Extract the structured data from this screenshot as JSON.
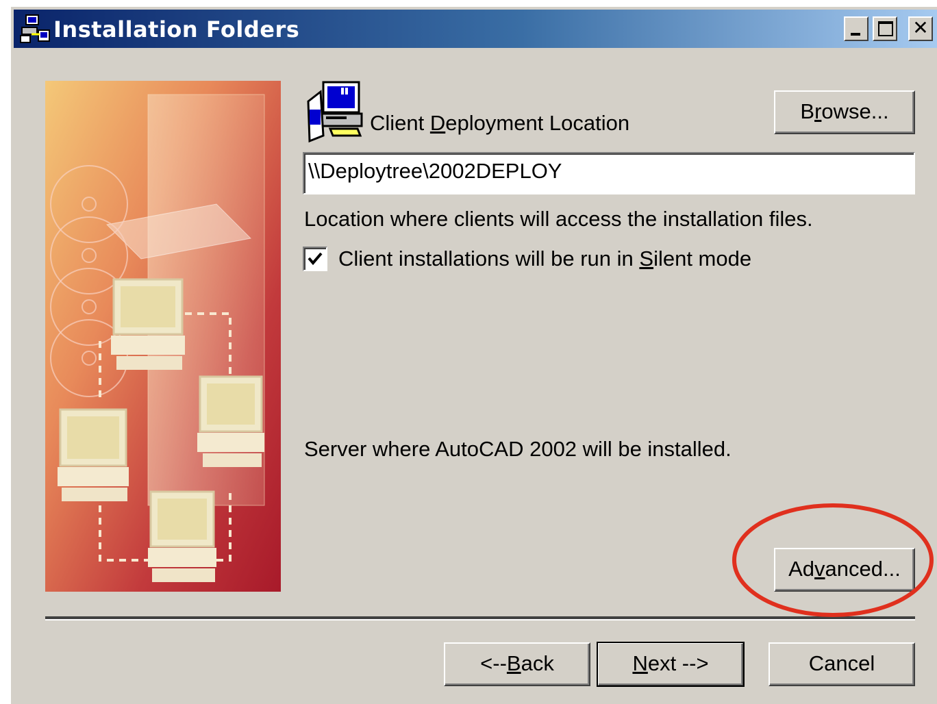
{
  "window": {
    "title": "Installation Folders"
  },
  "icons": {
    "app": "installer-icon",
    "deploy": "client-deployment-icon",
    "minimize": "minimize-icon",
    "maximize": "maximize-icon",
    "close": "close-icon"
  },
  "deployment": {
    "label_prefix": "Client ",
    "label_mnemonic": "D",
    "label_suffix": "eployment Location",
    "browse_prefix": "B",
    "browse_mnemonic": "r",
    "browse_suffix": "owse...",
    "path_value": "\\\\Deploytree\\2002DEPLOY",
    "hint": "Location where clients will access the installation files."
  },
  "silent": {
    "checked": true,
    "label_prefix": "Client installations will be run in ",
    "label_mnemonic": "S",
    "label_suffix": "ilent mode"
  },
  "server": {
    "text": "Server where AutoCAD 2002 will be installed."
  },
  "advanced": {
    "prefix": "Ad",
    "mnemonic": "v",
    "suffix": "anced..."
  },
  "nav": {
    "back_prefix": "<--",
    "back_mnemonic": "B",
    "back_suffix": "ack",
    "next_mnemonic": "N",
    "next_suffix": "ext -->",
    "cancel": "Cancel"
  },
  "colors": {
    "face": "#d4d0c8",
    "title_start": "#0a246a",
    "title_end": "#a6caf0",
    "highlight_ring": "#e0301e"
  }
}
